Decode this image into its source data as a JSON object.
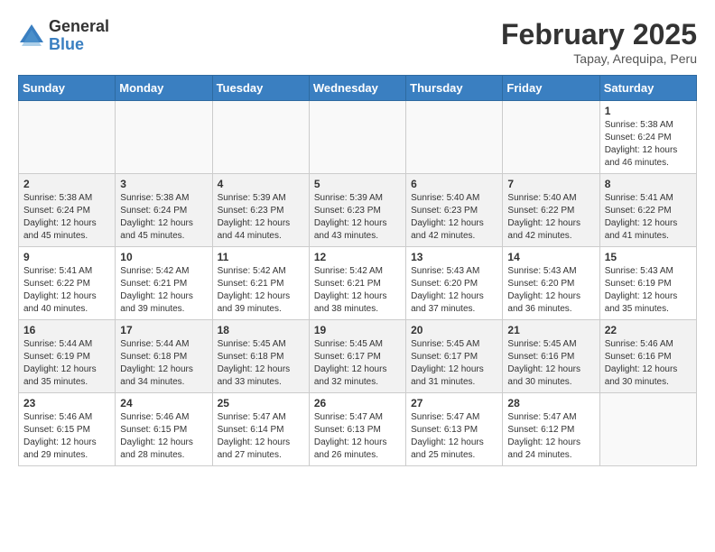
{
  "logo": {
    "general": "General",
    "blue": "Blue"
  },
  "title": "February 2025",
  "location": "Tapay, Arequipa, Peru",
  "weekdays": [
    "Sunday",
    "Monday",
    "Tuesday",
    "Wednesday",
    "Thursday",
    "Friday",
    "Saturday"
  ],
  "weeks": [
    [
      {
        "day": "",
        "info": ""
      },
      {
        "day": "",
        "info": ""
      },
      {
        "day": "",
        "info": ""
      },
      {
        "day": "",
        "info": ""
      },
      {
        "day": "",
        "info": ""
      },
      {
        "day": "",
        "info": ""
      },
      {
        "day": "1",
        "info": "Sunrise: 5:38 AM\nSunset: 6:24 PM\nDaylight: 12 hours and 46 minutes."
      }
    ],
    [
      {
        "day": "2",
        "info": "Sunrise: 5:38 AM\nSunset: 6:24 PM\nDaylight: 12 hours and 45 minutes."
      },
      {
        "day": "3",
        "info": "Sunrise: 5:38 AM\nSunset: 6:24 PM\nDaylight: 12 hours and 45 minutes."
      },
      {
        "day": "4",
        "info": "Sunrise: 5:39 AM\nSunset: 6:23 PM\nDaylight: 12 hours and 44 minutes."
      },
      {
        "day": "5",
        "info": "Sunrise: 5:39 AM\nSunset: 6:23 PM\nDaylight: 12 hours and 43 minutes."
      },
      {
        "day": "6",
        "info": "Sunrise: 5:40 AM\nSunset: 6:23 PM\nDaylight: 12 hours and 42 minutes."
      },
      {
        "day": "7",
        "info": "Sunrise: 5:40 AM\nSunset: 6:22 PM\nDaylight: 12 hours and 42 minutes."
      },
      {
        "day": "8",
        "info": "Sunrise: 5:41 AM\nSunset: 6:22 PM\nDaylight: 12 hours and 41 minutes."
      }
    ],
    [
      {
        "day": "9",
        "info": "Sunrise: 5:41 AM\nSunset: 6:22 PM\nDaylight: 12 hours and 40 minutes."
      },
      {
        "day": "10",
        "info": "Sunrise: 5:42 AM\nSunset: 6:21 PM\nDaylight: 12 hours and 39 minutes."
      },
      {
        "day": "11",
        "info": "Sunrise: 5:42 AM\nSunset: 6:21 PM\nDaylight: 12 hours and 39 minutes."
      },
      {
        "day": "12",
        "info": "Sunrise: 5:42 AM\nSunset: 6:21 PM\nDaylight: 12 hours and 38 minutes."
      },
      {
        "day": "13",
        "info": "Sunrise: 5:43 AM\nSunset: 6:20 PM\nDaylight: 12 hours and 37 minutes."
      },
      {
        "day": "14",
        "info": "Sunrise: 5:43 AM\nSunset: 6:20 PM\nDaylight: 12 hours and 36 minutes."
      },
      {
        "day": "15",
        "info": "Sunrise: 5:43 AM\nSunset: 6:19 PM\nDaylight: 12 hours and 35 minutes."
      }
    ],
    [
      {
        "day": "16",
        "info": "Sunrise: 5:44 AM\nSunset: 6:19 PM\nDaylight: 12 hours and 35 minutes."
      },
      {
        "day": "17",
        "info": "Sunrise: 5:44 AM\nSunset: 6:18 PM\nDaylight: 12 hours and 34 minutes."
      },
      {
        "day": "18",
        "info": "Sunrise: 5:45 AM\nSunset: 6:18 PM\nDaylight: 12 hours and 33 minutes."
      },
      {
        "day": "19",
        "info": "Sunrise: 5:45 AM\nSunset: 6:17 PM\nDaylight: 12 hours and 32 minutes."
      },
      {
        "day": "20",
        "info": "Sunrise: 5:45 AM\nSunset: 6:17 PM\nDaylight: 12 hours and 31 minutes."
      },
      {
        "day": "21",
        "info": "Sunrise: 5:45 AM\nSunset: 6:16 PM\nDaylight: 12 hours and 30 minutes."
      },
      {
        "day": "22",
        "info": "Sunrise: 5:46 AM\nSunset: 6:16 PM\nDaylight: 12 hours and 30 minutes."
      }
    ],
    [
      {
        "day": "23",
        "info": "Sunrise: 5:46 AM\nSunset: 6:15 PM\nDaylight: 12 hours and 29 minutes."
      },
      {
        "day": "24",
        "info": "Sunrise: 5:46 AM\nSunset: 6:15 PM\nDaylight: 12 hours and 28 minutes."
      },
      {
        "day": "25",
        "info": "Sunrise: 5:47 AM\nSunset: 6:14 PM\nDaylight: 12 hours and 27 minutes."
      },
      {
        "day": "26",
        "info": "Sunrise: 5:47 AM\nSunset: 6:13 PM\nDaylight: 12 hours and 26 minutes."
      },
      {
        "day": "27",
        "info": "Sunrise: 5:47 AM\nSunset: 6:13 PM\nDaylight: 12 hours and 25 minutes."
      },
      {
        "day": "28",
        "info": "Sunrise: 5:47 AM\nSunset: 6:12 PM\nDaylight: 12 hours and 24 minutes."
      },
      {
        "day": "",
        "info": ""
      }
    ]
  ]
}
